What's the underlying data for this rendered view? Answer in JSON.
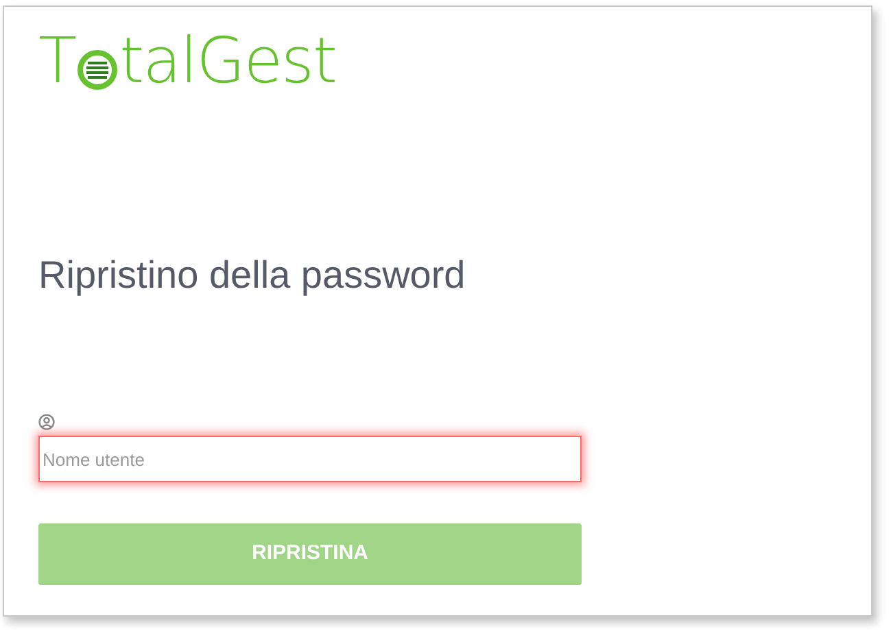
{
  "logo": {
    "before": "T",
    "after": "talGest"
  },
  "heading": "Ripristino della password",
  "username_field": {
    "placeholder": "Nome utente",
    "invalid": true
  },
  "submit_button": {
    "label": "RIPRISTINA",
    "disabled": true
  }
}
